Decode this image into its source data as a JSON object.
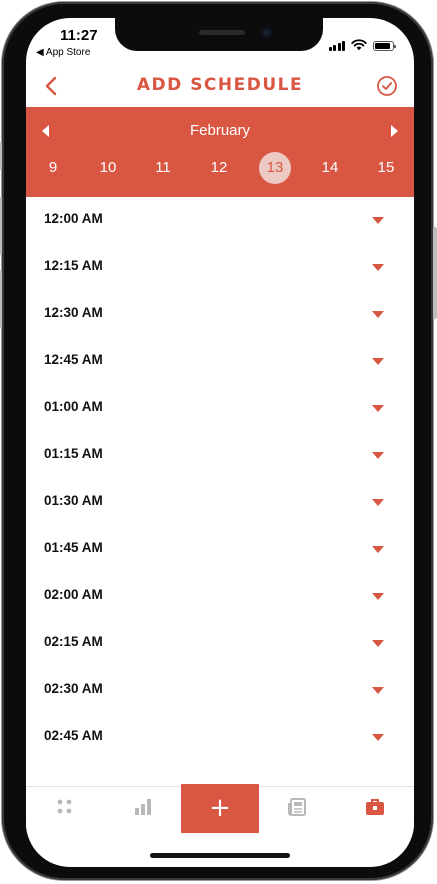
{
  "status_bar": {
    "time": "11:27",
    "back_app": "◀ App Store"
  },
  "header": {
    "title": "ADD SCHEDULE",
    "back_icon": "chevron-left-icon",
    "confirm_icon": "check-circle-icon"
  },
  "calendar": {
    "month": "February",
    "days": [
      "9",
      "10",
      "11",
      "12",
      "13",
      "14",
      "15"
    ],
    "selected_day": "13"
  },
  "time_slots": [
    "12:00 AM",
    "12:15 AM",
    "12:30 AM",
    "12:45 AM",
    "01:00 AM",
    "01:15 AM",
    "01:30 AM",
    "01:45 AM",
    "02:00 AM",
    "02:15 AM",
    "02:30 AM",
    "02:45 AM"
  ],
  "tab_bar": {
    "add_label": "+",
    "icons": [
      "grid-dots-icon",
      "bar-chart-icon",
      "add-icon",
      "newspaper-icon",
      "briefcase-icon"
    ]
  },
  "colors": {
    "accent": "#d95643",
    "selected_day_bg": "#ecc9c2",
    "tab_inactive": "#b8b8b8"
  }
}
